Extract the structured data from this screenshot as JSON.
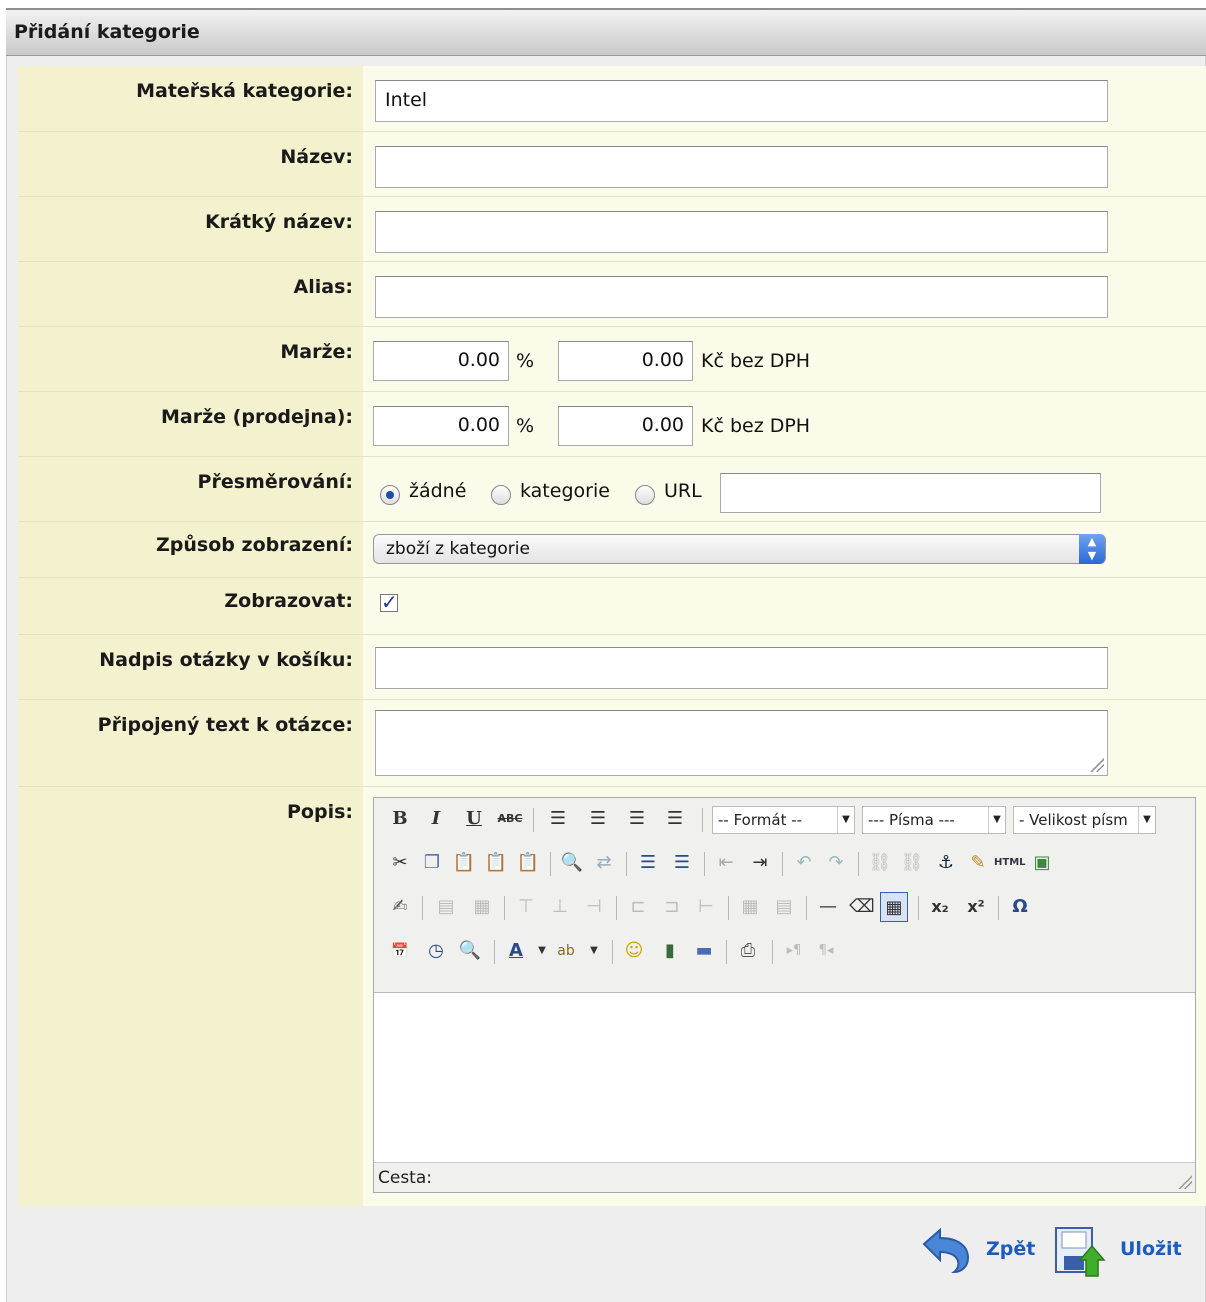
{
  "header": {
    "title": "Přidání kategorie"
  },
  "fields": {
    "parent_label": "Mateřská kategorie:",
    "parent_value": "Intel",
    "name_label": "Název:",
    "name_value": "",
    "short_label": "Krátký název:",
    "short_value": "",
    "alias_label": "Alias:",
    "alias_value": "",
    "margin_label": "Marže:",
    "margin_pct": "0.00",
    "margin_pct_unit": "%",
    "margin_abs": "0.00",
    "margin_abs_unit": "Kč bez DPH",
    "store_margin_label": "Marže (prodejna):",
    "store_margin_pct": "0.00",
    "store_margin_pct_unit": "%",
    "store_margin_abs": "0.00",
    "store_margin_abs_unit": "Kč bez DPH",
    "redirect_label": "Přesměrování:",
    "redirect_options": [
      "žádné",
      "kategorie",
      "URL"
    ],
    "redirect_selected": "žádné",
    "redirect_url": "",
    "display_mode_label": "Způsob zobrazení:",
    "display_mode_value": "zboží z kategorie",
    "show_label": "Zobrazovat:",
    "show_checked": true,
    "cart_question_label": "Nadpis otázky v košíku:",
    "cart_question_value": "",
    "question_text_label": "Připojený text k otázce:",
    "question_text_value": "",
    "description_label": "Popis:"
  },
  "editor": {
    "format_select": "-- Formát --",
    "font_select": "--- Písma ---",
    "size_select": "- Velikost písm",
    "path_label": "Cesta:",
    "toolbar_icons": [
      "bold-icon",
      "italic-icon",
      "underline-icon",
      "strikethrough-icon",
      "align-left-icon",
      "align-center-icon",
      "align-right-icon",
      "align-justify-icon",
      "cut-icon",
      "copy-icon",
      "paste-icon",
      "paste-text-icon",
      "paste-word-icon",
      "find-icon",
      "replace-icon",
      "bullet-list-icon",
      "numbered-list-icon",
      "outdent-icon",
      "indent-icon",
      "undo-icon",
      "redo-icon",
      "link-icon",
      "unlink-icon",
      "anchor-icon",
      "cleanup-icon",
      "html-icon",
      "image-icon",
      "edit-icon",
      "table-icon",
      "hr-icon",
      "eraser-icon",
      "visual-aid-icon",
      "subscript-icon",
      "superscript-icon",
      "charmap-icon",
      "insert-date-icon",
      "insert-time-icon",
      "preview-icon",
      "text-color-icon",
      "highlight-color-icon",
      "emoticon-icon",
      "media-icon",
      "pagebreak-icon",
      "print-icon",
      "ltr-icon",
      "rtl-icon"
    ]
  },
  "actions": {
    "back_label": "Zpět",
    "save_label": "Uložit"
  }
}
